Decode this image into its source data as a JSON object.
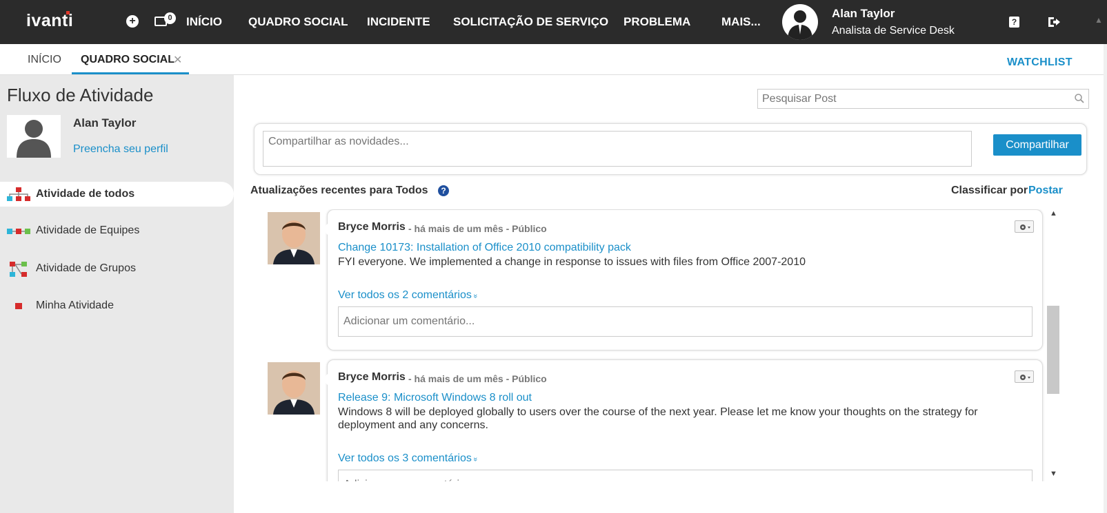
{
  "topbar": {
    "logo": "ivanti",
    "chat_count": "0",
    "nav": [
      "INÍCIO",
      "QUADRO SOCIAL",
      "INCIDENTE",
      "SOLICITAÇÃO DE SERVIÇO",
      "PROBLEMA",
      "MAIS..."
    ],
    "user_name": "Alan Taylor",
    "user_role": "Analista de Service Desk"
  },
  "tabs": {
    "items": [
      "INÍCIO",
      "QUADRO SOCIAL"
    ],
    "close_glyph": "✕",
    "watchlist": "WATCHLIST"
  },
  "sidebar": {
    "title": "Fluxo de Atividade",
    "user_name": "Alan Taylor",
    "profile_link": "Preencha seu perfil",
    "items": [
      {
        "label": "Atividade de todos",
        "icon": "all-activity-icon"
      },
      {
        "label": "Atividade de Equipes",
        "icon": "team-activity-icon"
      },
      {
        "label": "Atividade de Grupos",
        "icon": "group-activity-icon"
      },
      {
        "label": "Minha Atividade",
        "icon": "my-activity-icon"
      }
    ]
  },
  "main": {
    "search_placeholder": "Pesquisar Post",
    "share_placeholder": "Compartilhar as novidades...",
    "share_button": "Compartilhar",
    "updates_title": "Atualizações recentes para Todos",
    "help_glyph": "?",
    "sort_label": "Classificar por",
    "sort_value": "Postar",
    "posts": [
      {
        "author": "Bryce Morris",
        "meta": "- há mais de um mês - Público",
        "link": "Change 10173: Installation of Office 2010 compatibility pack",
        "body": "FYI everyone. We implemented a change in response to issues with files from Office 2007-2010",
        "comments_link": "Ver todos os 2 comentários",
        "comment_placeholder": "Adicionar um comentário..."
      },
      {
        "author": "Bryce Morris",
        "meta": "- há mais de um mês - Público",
        "link": "Release 9: Microsoft Windows 8 roll out",
        "body": "Windows 8 will be deployed globally to users over the course of the next year. Please let me know your thoughts on the strategy for deployment and any concerns.",
        "comments_link": "Ver todos os 3 comentários",
        "comment_placeholder": "Adicionar um comentário..."
      }
    ]
  },
  "colors": {
    "topbar_bg": "#2b2b2b",
    "accent": "#1a8fc9",
    "sidebar_bg": "#e9e9e9"
  }
}
